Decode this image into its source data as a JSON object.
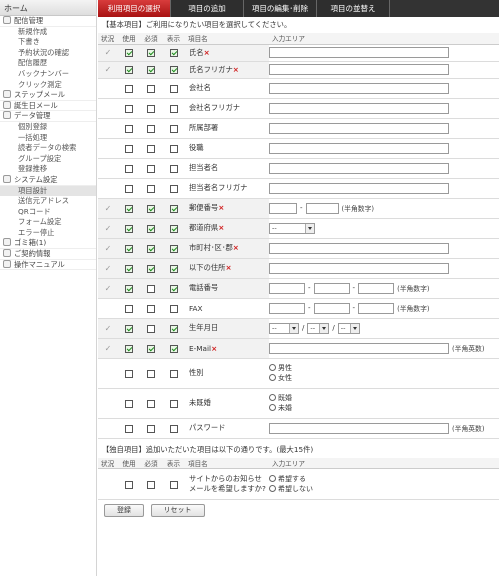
{
  "sidebar": {
    "home": "ホーム",
    "sections": [
      {
        "label": "配信管理",
        "icon": "gear-icon",
        "items": [
          "新規作成",
          "下書き",
          "予約状況の確認",
          "配信履歴",
          "バックナンバー",
          "クリック測定"
        ]
      },
      {
        "label": "ステップメール",
        "icon": "step-icon",
        "items": []
      },
      {
        "label": "誕生日メール",
        "icon": "cake-icon",
        "items": []
      },
      {
        "label": "データ管理",
        "icon": "database-icon",
        "items": [
          "個別登録",
          "一括処理",
          "読者データの検索",
          "グループ設定",
          "登録推移"
        ]
      },
      {
        "label": "システム設定",
        "icon": "wrench-icon",
        "items": [
          "項目設計",
          "送信元アドレス",
          "QRコード",
          "フォーム設定",
          "エラー停止"
        ]
      },
      {
        "label": "ゴミ箱(1)",
        "icon": "trash-icon",
        "items": []
      },
      {
        "label": "ご契約情報",
        "icon": "contract-icon",
        "items": []
      },
      {
        "label": "操作マニュアル",
        "icon": "manual-icon",
        "items": []
      }
    ],
    "active_item": "項目設計"
  },
  "tabs": [
    "利用項目の選択",
    "項目の追加",
    "項目の編集･削除",
    "項目の並替え"
  ],
  "basic_note": "【基本項目】ご利用になりたい項目を選択してください。",
  "headers": {
    "status": "状況",
    "use": "使用",
    "required": "必須",
    "display": "表示",
    "name": "項目名",
    "input": "入力エリア"
  },
  "rows": [
    {
      "status": "✓",
      "use": true,
      "req": true,
      "disp": true,
      "label": "氏名",
      "required_mark": "×",
      "input": "text-full"
    },
    {
      "status": "✓",
      "use": true,
      "req": true,
      "disp": true,
      "label": "氏名フリガナ",
      "required_mark": "×",
      "input": "text-full"
    },
    {
      "status": "",
      "use": false,
      "req": false,
      "disp": false,
      "label": "会社名",
      "required_mark": "",
      "input": "text-full"
    },
    {
      "status": "",
      "use": false,
      "req": false,
      "disp": false,
      "label": "会社名フリガナ",
      "required_mark": "",
      "input": "text-full"
    },
    {
      "status": "",
      "use": false,
      "req": false,
      "disp": false,
      "label": "所属部署",
      "required_mark": "",
      "input": "text-full"
    },
    {
      "status": "",
      "use": false,
      "req": false,
      "disp": false,
      "label": "役職",
      "required_mark": "",
      "input": "text-full"
    },
    {
      "status": "",
      "use": false,
      "req": false,
      "disp": false,
      "label": "担当者名",
      "required_mark": "",
      "input": "text-full"
    },
    {
      "status": "",
      "use": false,
      "req": false,
      "disp": false,
      "label": "担当者名フリガナ",
      "required_mark": "",
      "input": "text-full"
    },
    {
      "status": "✓",
      "use": true,
      "req": true,
      "disp": true,
      "label": "郵便番号",
      "required_mark": "×",
      "input": "zip",
      "note": "(半角数字)"
    },
    {
      "status": "✓",
      "use": true,
      "req": true,
      "disp": true,
      "label": "都道府県",
      "required_mark": "×",
      "input": "pref",
      "select_value": "--"
    },
    {
      "status": "✓",
      "use": true,
      "req": true,
      "disp": true,
      "label": "市町村･区･郡",
      "required_mark": "×",
      "input": "text-full"
    },
    {
      "status": "✓",
      "use": true,
      "req": true,
      "disp": true,
      "label": "以下の住所",
      "required_mark": "×",
      "input": "text-full"
    },
    {
      "status": "✓",
      "use": true,
      "req": false,
      "disp": true,
      "label": "電話番号",
      "required_mark": "",
      "input": "phone",
      "note": "(半角数字)"
    },
    {
      "status": "",
      "use": false,
      "req": false,
      "disp": false,
      "label": "FAX",
      "required_mark": "",
      "input": "phone",
      "note": "(半角数字)"
    },
    {
      "status": "✓",
      "use": true,
      "req": false,
      "disp": true,
      "label": "生年月日",
      "required_mark": "",
      "input": "date",
      "select_value": "--"
    },
    {
      "status": "✓",
      "use": true,
      "req": true,
      "disp": true,
      "label": "E-Mail",
      "required_mark": "×",
      "input": "email",
      "note": "(半角英数)"
    },
    {
      "status": "",
      "use": false,
      "req": false,
      "disp": false,
      "label": "性別",
      "required_mark": "",
      "input": "radio",
      "options": [
        "男性",
        "女性"
      ]
    },
    {
      "status": "",
      "use": false,
      "req": false,
      "disp": false,
      "label": "未既婚",
      "required_mark": "",
      "input": "radio",
      "options": [
        "既婚",
        "未婚"
      ]
    },
    {
      "status": "",
      "use": false,
      "req": false,
      "disp": false,
      "label": "パスワード",
      "required_mark": "",
      "input": "email",
      "note": "(半角英数)"
    }
  ],
  "custom_note": "【独自項目】追加いただいた項目は以下の通りです。(最大15件)",
  "custom_rows": [
    {
      "status": "",
      "use": false,
      "req": false,
      "disp": false,
      "label": "サイトからのお知らせメールを希望しますか?",
      "required_mark": "",
      "input": "radio",
      "options": [
        "希望する",
        "希望しない"
      ]
    }
  ],
  "buttons": {
    "register": "登録",
    "reset": "リセット"
  },
  "colors": {
    "required_mark": "#d02020",
    "active_tab": "#c02020",
    "tab_bar": "#333333",
    "check": "#1a8a1a"
  }
}
